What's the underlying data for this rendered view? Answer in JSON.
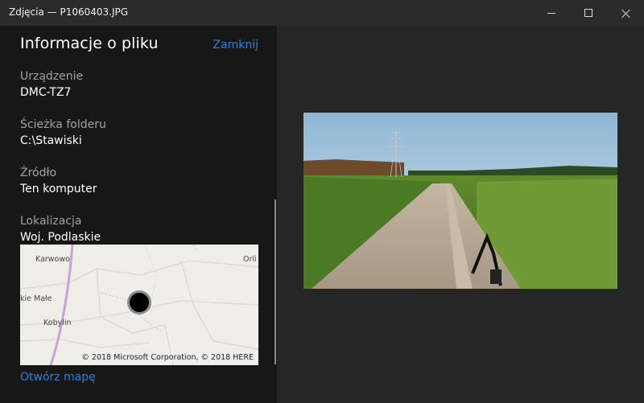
{
  "window": {
    "title": "Zdjęcia — P1060403.JPG"
  },
  "panel": {
    "title": "Informacje o pliku",
    "close_label": "Zamknij",
    "fields": [
      {
        "label": "Urządzenie",
        "value": "DMC-TZ7"
      },
      {
        "label": "Ścieżka folderu",
        "value": "C:\\Stawiski"
      },
      {
        "label": "Źródło",
        "value": "Ten komputer"
      },
      {
        "label": "Lokalizacja",
        "value": "Woj. Podlaskie"
      }
    ],
    "map": {
      "places": [
        "Karwowo",
        "Orli",
        "kie Małe",
        "Kobylin"
      ],
      "copyright": "© 2018 Microsoft Corporation, © 2018 HERE"
    },
    "open_map_label": "Otwórz mapę"
  },
  "colors": {
    "accent": "#2a82d8",
    "panel_bg": "#171717",
    "viewer_bg": "#262626"
  }
}
